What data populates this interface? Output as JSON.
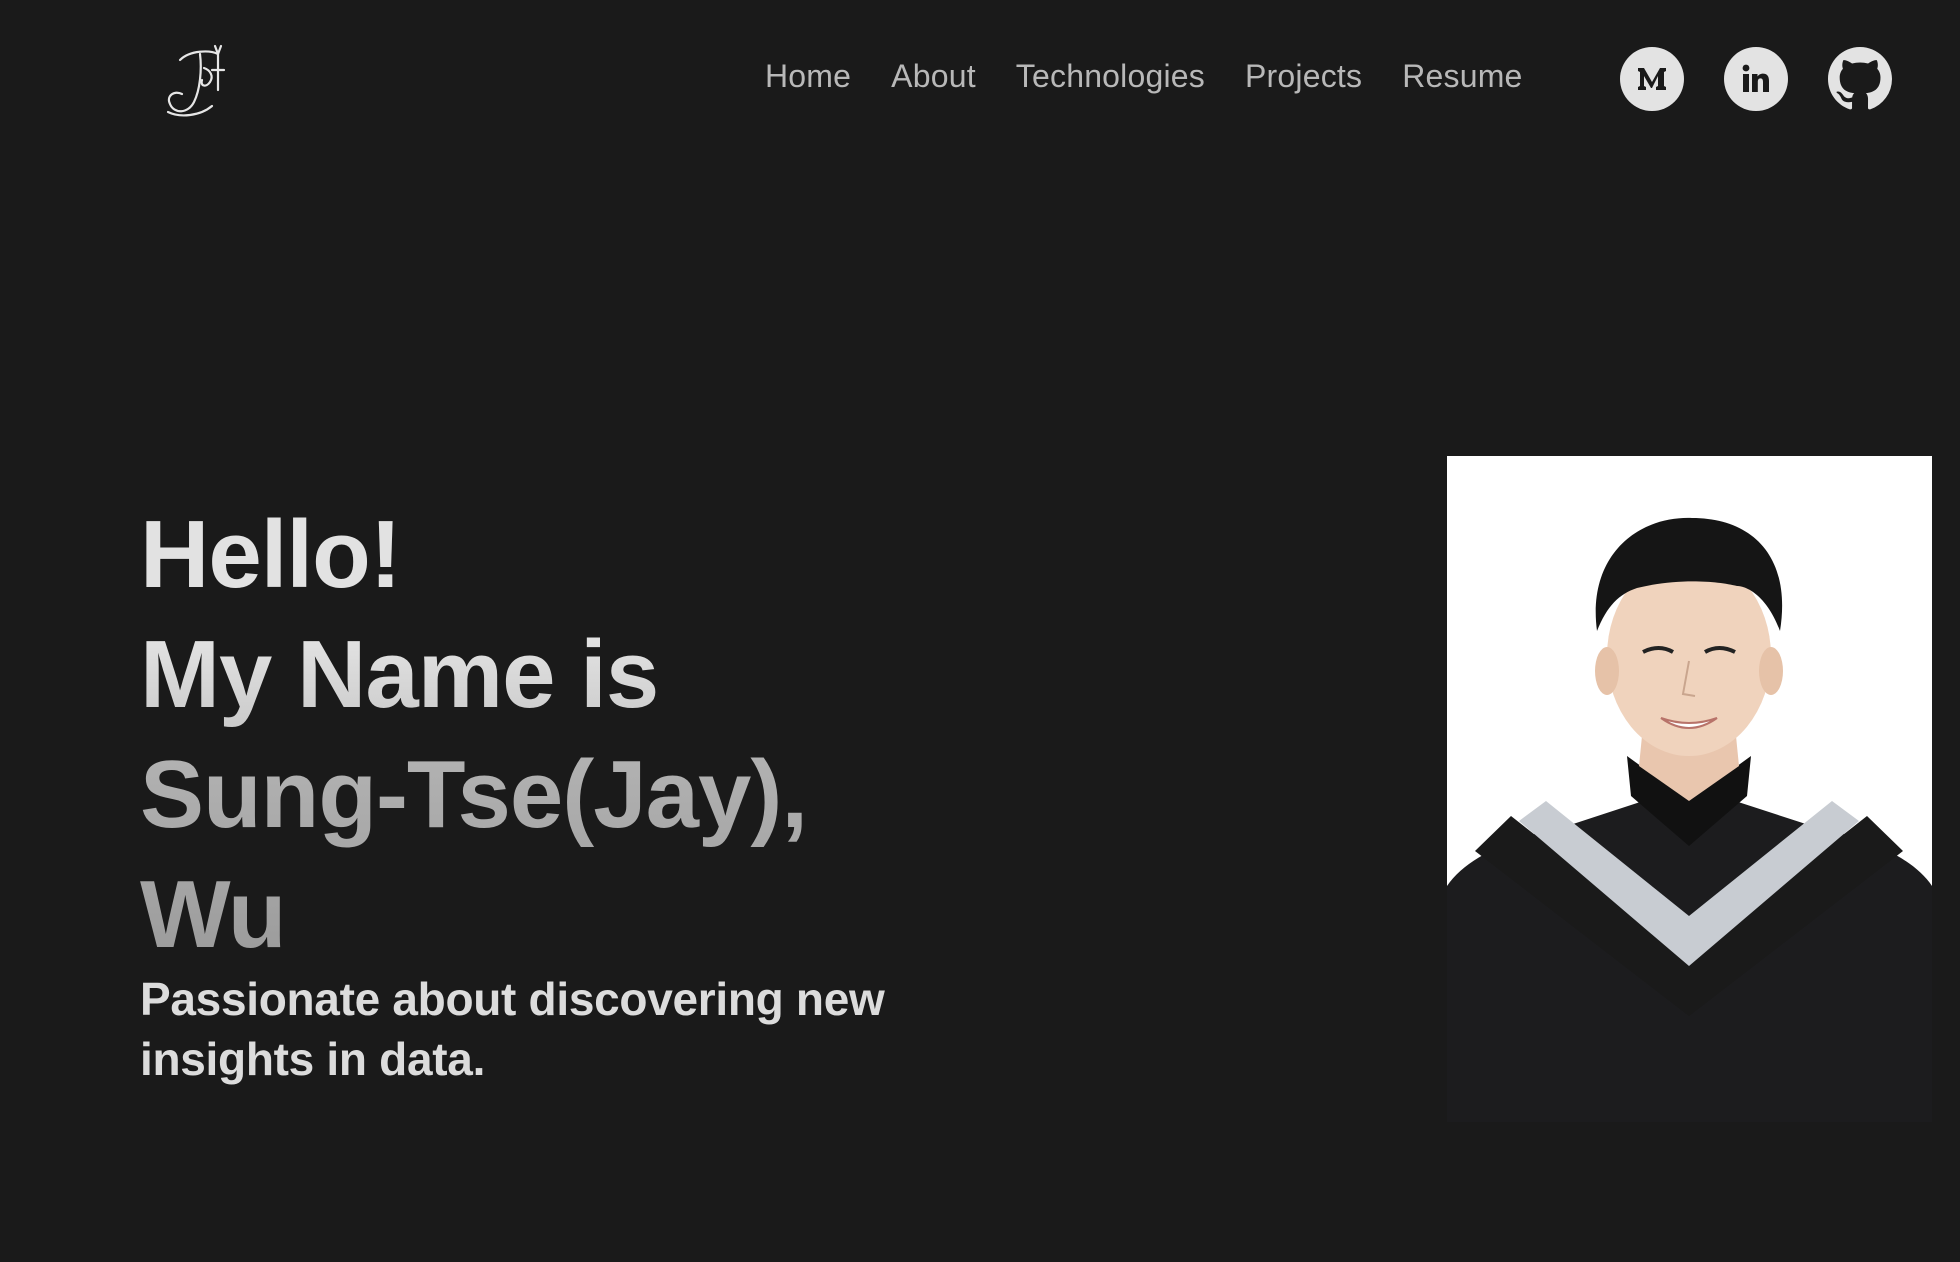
{
  "nav": {
    "items": [
      {
        "label": "Home"
      },
      {
        "label": "About"
      },
      {
        "label": "Technologies"
      },
      {
        "label": "Projects"
      },
      {
        "label": "Resume"
      }
    ]
  },
  "social": [
    {
      "icon": "medium-icon"
    },
    {
      "icon": "linkedin-icon"
    },
    {
      "icon": "github-icon"
    }
  ],
  "hero": {
    "line1": "Hello!",
    "line2": "My Name is",
    "line3": "Sung-Tse(Jay), Wu",
    "tagline": "Passionate about discovering new insights in data."
  },
  "colors": {
    "background": "#1a1a1a",
    "nav_text": "#b8b8b8",
    "icon_bg": "#e3e3e3"
  }
}
